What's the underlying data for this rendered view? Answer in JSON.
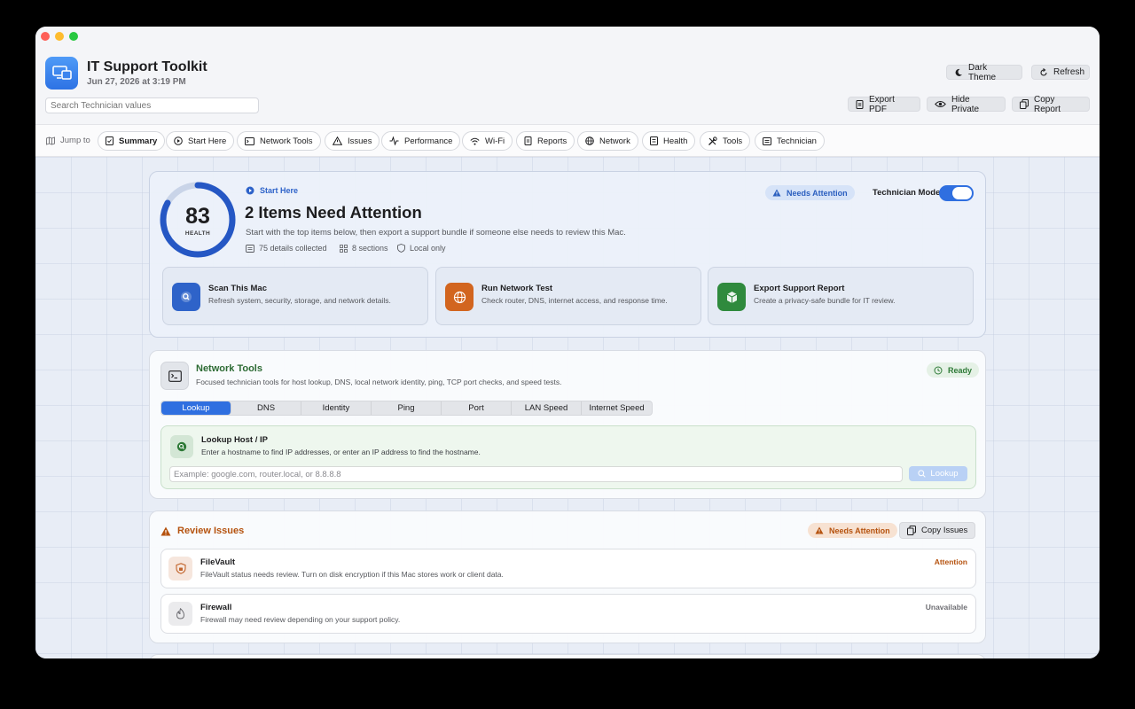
{
  "app": {
    "title": "IT Support Toolkit",
    "date": "Jun 27, 2026 at 3:19 PM",
    "search_placeholder": "Search Technician values"
  },
  "toolbar": {
    "dark_theme": "Dark Theme",
    "refresh": "Refresh",
    "export_pdf": "Export PDF",
    "hide_private": "Hide Private",
    "copy_report": "Copy Report"
  },
  "nav": {
    "jump_label": "Jump to",
    "items": [
      "Summary",
      "Start Here",
      "Network Tools",
      "Issues",
      "Performance",
      "Wi-Fi",
      "Reports",
      "Network",
      "Health",
      "Tools",
      "Technician"
    ],
    "active": "Summary"
  },
  "hero": {
    "score": "83",
    "score_label": "HEALTH",
    "score_fraction": 0.83,
    "kicker": "Start Here",
    "title": "2 Items Need Attention",
    "subtitle": "Start with the top items below, then export a support bundle if someone else needs to review this Mac.",
    "meta": [
      "75 details collected",
      "8 sections",
      "Local only"
    ],
    "badge": "Needs Attention",
    "technician_mode_label": "Technician Mode",
    "technician_mode_on": true,
    "actions": [
      {
        "title": "Scan This Mac",
        "desc": "Refresh system, security, storage, and network details.",
        "color": "#2e63c9"
      },
      {
        "title": "Run Network Test",
        "desc": "Check router, DNS, internet access, and response time.",
        "color": "#d2651f"
      },
      {
        "title": "Export Support Report",
        "desc": "Create a privacy-safe bundle for IT review.",
        "color": "#2f8a3d"
      }
    ]
  },
  "network_tools": {
    "title": "Network Tools",
    "desc": "Focused technician tools for host lookup, DNS, local network identity, ping, TCP port checks, and speed tests.",
    "status": "Ready",
    "tabs": [
      "Lookup",
      "DNS",
      "Identity",
      "Ping",
      "Port",
      "LAN Speed",
      "Internet Speed"
    ],
    "selected_tab": "Lookup",
    "lookup": {
      "title": "Lookup Host / IP",
      "desc": "Enter a hostname to find IP addresses, or enter an IP address to find the hostname.",
      "placeholder": "Example: google.com, router.local, or 8.8.8.8",
      "button": "Lookup"
    }
  },
  "issues": {
    "title": "Review Issues",
    "badge": "Needs Attention",
    "copy_button": "Copy Issues",
    "items": [
      {
        "title": "FileVault",
        "desc": "FileVault status needs review. Turn on disk encryption if this Mac stores work or client data.",
        "status": "Attention",
        "status_color": "#b5520e"
      },
      {
        "title": "Firewall",
        "desc": "Firewall may need review depending on your support policy.",
        "status": "Unavailable",
        "status_color": "#6e6e73"
      }
    ]
  }
}
